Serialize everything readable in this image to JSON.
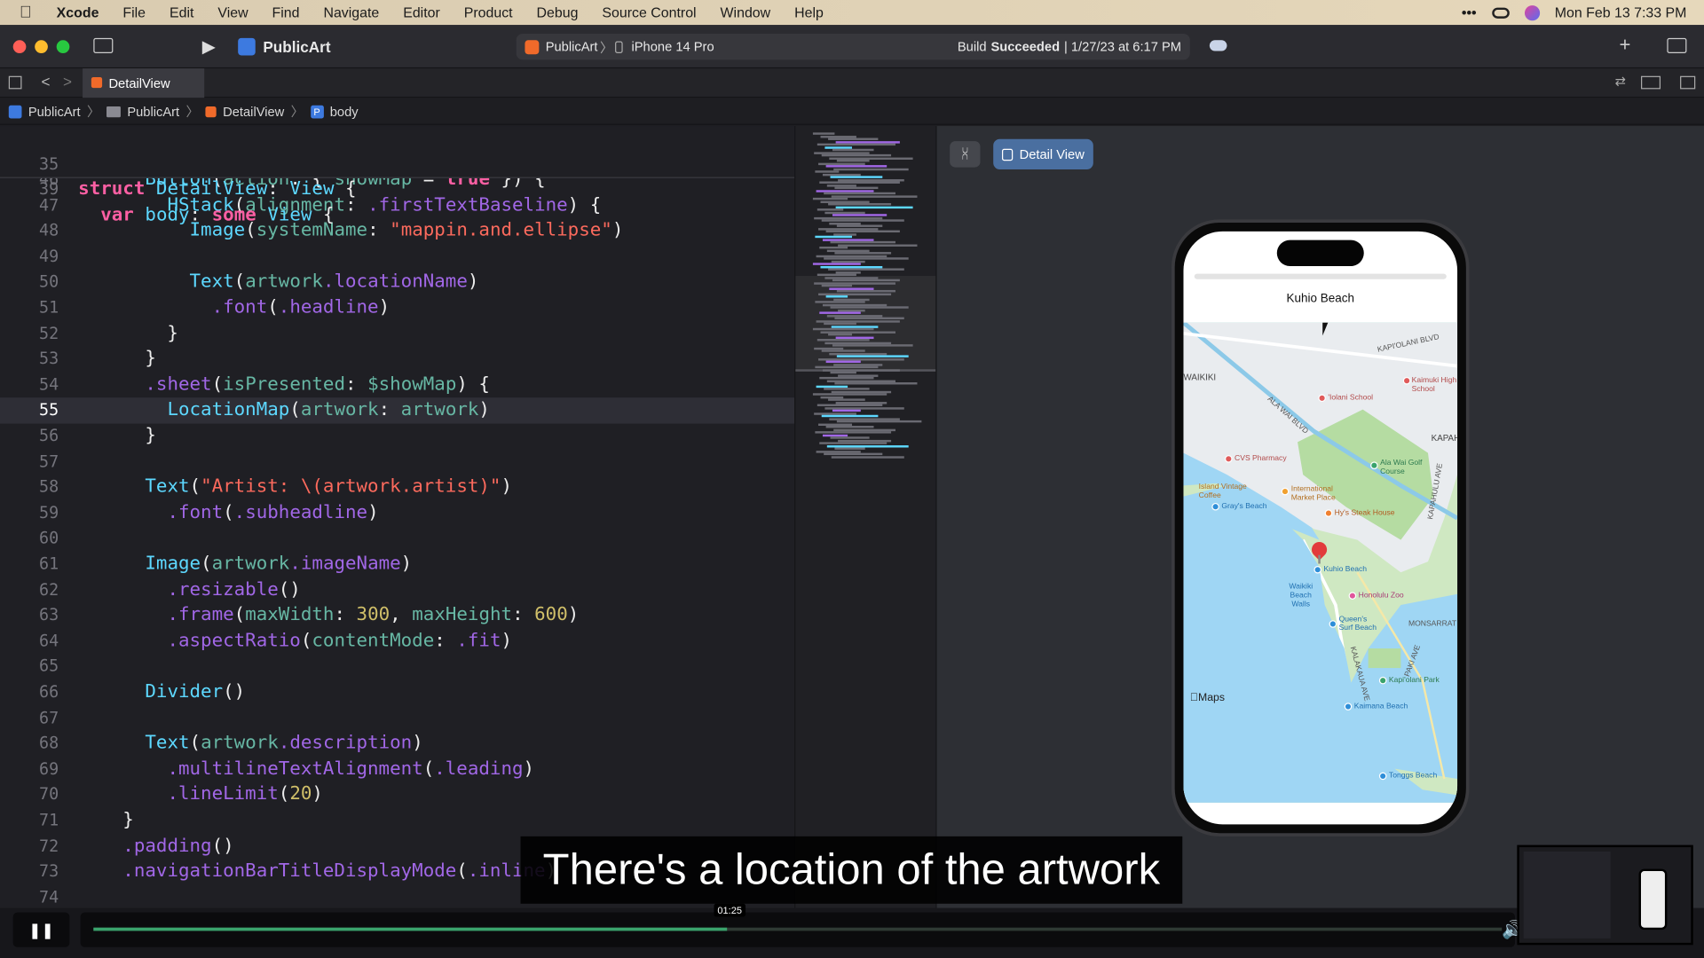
{
  "menubar": {
    "items": [
      "Xcode",
      "File",
      "Edit",
      "View",
      "Find",
      "Navigate",
      "Editor",
      "Product",
      "Debug",
      "Source Control",
      "Window",
      "Help"
    ],
    "datetime": "Mon Feb 13  7:33 PM"
  },
  "toolbar": {
    "project": "PublicArt",
    "scheme": "PublicArt",
    "device": "iPhone 14 Pro",
    "build_status_prefix": "Build",
    "build_status": "Succeeded",
    "build_time": "| 1/27/23 at 6:17 PM"
  },
  "tab": {
    "label": "DetailView"
  },
  "breadcrumb": [
    "PublicArt",
    "PublicArt",
    "DetailView",
    "body"
  ],
  "sticky": [
    {
      "num": "35",
      "code": "struct DetailView: View {"
    },
    {
      "num": "39",
      "code": "  var body: some View {"
    }
  ],
  "code_lines": [
    {
      "num": "46",
      "text": "      Button(action: { showMap = true }) {"
    },
    {
      "num": "47",
      "text": "        HStack(alignment: .firstTextBaseline) {"
    },
    {
      "num": "48",
      "text": "          Image(systemName: \"mappin.and.ellipse\")"
    },
    {
      "num": "49",
      "text": ""
    },
    {
      "num": "50",
      "text": "          Text(artwork.locationName)"
    },
    {
      "num": "51",
      "text": "            .font(.headline)"
    },
    {
      "num": "52",
      "text": "        }"
    },
    {
      "num": "53",
      "text": "      }"
    },
    {
      "num": "54",
      "text": "      .sheet(isPresented: $showMap) {"
    },
    {
      "num": "55",
      "text": "        LocationMap(artwork: artwork)"
    },
    {
      "num": "56",
      "text": "      }"
    },
    {
      "num": "57",
      "text": ""
    },
    {
      "num": "58",
      "text": "      Text(\"Artist: \\(artwork.artist)\")"
    },
    {
      "num": "59",
      "text": "        .font(.subheadline)"
    },
    {
      "num": "60",
      "text": ""
    },
    {
      "num": "61",
      "text": "      Image(artwork.imageName)"
    },
    {
      "num": "62",
      "text": "        .resizable()"
    },
    {
      "num": "63",
      "text": "        .frame(maxWidth: 300, maxHeight: 600)"
    },
    {
      "num": "64",
      "text": "        .aspectRatio(contentMode: .fit)"
    },
    {
      "num": "65",
      "text": ""
    },
    {
      "num": "66",
      "text": "      Divider()"
    },
    {
      "num": "67",
      "text": ""
    },
    {
      "num": "68",
      "text": "      Text(artwork.description)"
    },
    {
      "num": "69",
      "text": "        .multilineTextAlignment(.leading)"
    },
    {
      "num": "70",
      "text": "        .lineLimit(20)"
    },
    {
      "num": "71",
      "text": "    }"
    },
    {
      "num": "72",
      "text": "    .padding()"
    },
    {
      "num": "73",
      "text": "    .navigationBarTitleDisplayMode(.inline)"
    },
    {
      "num": "74",
      "text": ""
    }
  ],
  "highlighted_line": "55",
  "preview": {
    "button": "Detail View",
    "sheet_title": "Kuhio Beach",
    "maps_logo": "Maps",
    "map_labels": [
      "KAPI'OLANI BLVD",
      "Kaimuki High School",
      "'Iolani School",
      "ALA WAI BLVD",
      "CVS Pharmacy",
      "Ala Wai Golf Course",
      "International Market Place",
      "Island Vintage Coffee",
      "Gray's Beach",
      "Hy's Steak House",
      "Kuhio Beach",
      "Waikiki Beach Walls",
      "Honolulu Zoo",
      "Queen's Surf Beach",
      "MONSARRAT AVE",
      "KALAKAUA AVE",
      "Kapi'olani Park",
      "Kaimana Beach",
      "Tonggs Beach",
      "PAKI AVE",
      "KAPAHULU AVE",
      "WAIKIKI",
      "KAPAH"
    ]
  },
  "caption": "There's a location of the artwork",
  "video": {
    "time": "01:25",
    "progress": 0.45
  },
  "colors": {
    "accent": "#3aa36c",
    "preview_button": "#4a6fa0"
  }
}
